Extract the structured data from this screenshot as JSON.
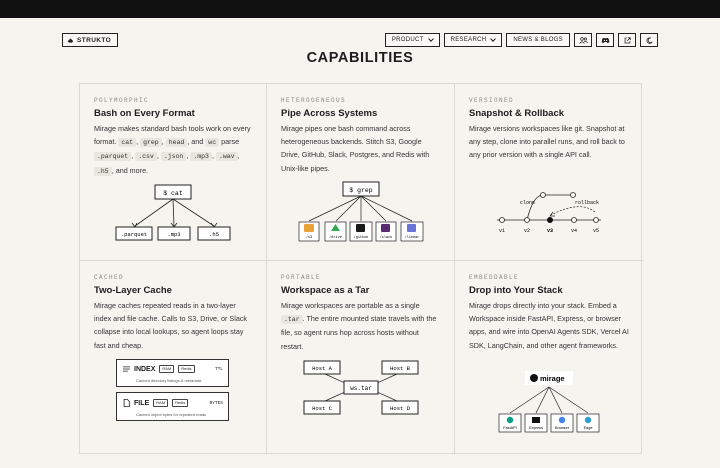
{
  "nav": {
    "logo": "STRUKTO",
    "items": [
      {
        "label": "PRODUCT",
        "dropdown": true
      },
      {
        "label": "RESEARCH",
        "dropdown": true
      },
      {
        "label": "NEWS & BLOGS",
        "dropdown": false
      }
    ],
    "icons": [
      "community-icon",
      "discord-icon",
      "external-link-icon",
      "theme-toggle-icon"
    ]
  },
  "page": {
    "title": "CAPABILITIES"
  },
  "cards": {
    "polymorphic": {
      "tag": "POLYMORPHIC",
      "title": "Bash on Every Format",
      "desc_1": "Mirage makes standard bash tools work on every format.",
      "cmd_cat": "cat",
      "cmd_grep": "grep",
      "cmd_head": "head",
      "and": ", and",
      "cmd_wc": "wc",
      "parse": "parse",
      "ext_parquet": ".parquet",
      "ext_csv": ".csv",
      "ext_json": ".json",
      "ext_mp3": ".mp3",
      "ext_wav": ".wav",
      "ext_h5": ".h5",
      "and_more": ", and more.",
      "root": "$ cat",
      "leaves": [
        ".parquet",
        ".mp3",
        ".h5"
      ]
    },
    "heterogeneous": {
      "tag": "HETEROGENEOUS",
      "title": "Pipe Across Systems",
      "desc": "Mirage pipes one bash command across heterogeneous backends. Stitch S3, Google Drive, GitHub, Slack, Postgres, and Redis with Unix-like pipes.",
      "root": "$ grep",
      "leaves": [
        "/s3",
        "/drive",
        "/github",
        "/slack",
        "/linear"
      ]
    },
    "versioned": {
      "tag": "VERSIONED",
      "title": "Snapshot & Rollback",
      "desc": "Mirage versions workspaces like git. Snapshot at any step, clone into parallel runs, and roll back to any prior version with a single API call.",
      "clone_label": "clone",
      "rollback_label": "rollback",
      "versions": [
        "v1",
        "v2",
        "v3",
        "v4",
        "v5"
      ]
    },
    "cached": {
      "tag": "CACHED",
      "title": "Two-Layer Cache",
      "desc": "Mirage caches repeated reads in a two-layer index and file cache. Calls to S3, Drive, or Slack collapse into local lookups, so agent loops stay fast and cheap.",
      "layers": [
        {
          "name": "INDEX",
          "pills": [
            "RAM",
            "Redis"
          ],
          "meta": "TTL",
          "caption": "Cached directory listings & metadata"
        },
        {
          "name": "FILE",
          "pills": [
            "RAM",
            "Redis"
          ],
          "meta": "BYTES",
          "caption": "Cached object bytes for repeated reads"
        }
      ]
    },
    "portable": {
      "tag": "PORTABLE",
      "title": "Workspace as a Tar",
      "desc_1": "Mirage workspaces are portable as a single",
      "tar": ".tar",
      "desc_2": ". The entire mounted state travels with the file, so agent runs hop across hosts without restart.",
      "center": "ws.tar",
      "hosts": [
        "Host A",
        "Host B",
        "Host C",
        "Host D"
      ]
    },
    "embeddable": {
      "tag": "EMBEDDABLE",
      "title": "Drop into Your Stack",
      "desc": "Mirage drops directly into your stack. Embed a Workspace inside FastAPI, Express, or browser apps, and wire into OpenAI Agents SDK, Vercel AI SDK, LangChain, and other agent frameworks.",
      "root": "mirage",
      "targets": [
        "FastAPI",
        "Express",
        "Browser",
        "Edge"
      ]
    }
  }
}
